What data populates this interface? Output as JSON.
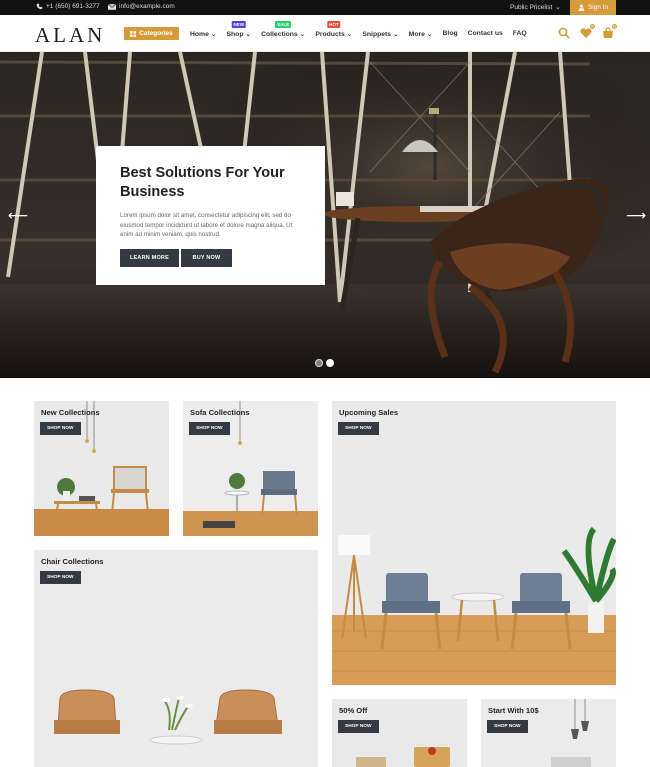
{
  "topbar": {
    "phone": "+1 (650) 691-3277",
    "email": "info@example.com",
    "pricelist": "Public Pricelist",
    "signin": "Sign In"
  },
  "header": {
    "logo": "ALAN",
    "categories": "Categories",
    "nav": [
      {
        "label": "Home",
        "dropdown": true
      },
      {
        "label": "Shop",
        "dropdown": true,
        "badge": "NEW",
        "badge_color": "#5b3fd6"
      },
      {
        "label": "Collections",
        "dropdown": true,
        "badge": "SALE",
        "badge_color": "#2ecc71"
      },
      {
        "label": "Products",
        "dropdown": true,
        "badge": "HOT",
        "badge_color": "#e74c3c"
      },
      {
        "label": "Snippets",
        "dropdown": true
      },
      {
        "label": "More",
        "dropdown": true
      },
      {
        "label": "Blog",
        "dropdown": false
      },
      {
        "label": "Contact us",
        "dropdown": false
      },
      {
        "label": "FAQ",
        "dropdown": false
      }
    ],
    "icons": {
      "search": "search-icon",
      "wishlist": "heart-icon",
      "cart": "cart-icon",
      "wishlist_count": "0",
      "cart_count": "0"
    }
  },
  "hero": {
    "title": "Best Solutions For Your Business",
    "text": "Lorem ipsum dolor sit amet, consectetur adipiscing elit, sed do eiusmod tempor incididunt ut labore et dolore magna aliqua. Ut enim ad minim veniam, quis nostrud.",
    "btn_learn": "LEARN MORE",
    "btn_buy": "BUY NOW",
    "slides": 2,
    "active_slide": 2
  },
  "collections": [
    {
      "title": "New Collections",
      "button": "SHOP NOW"
    },
    {
      "title": "Sofa Collections",
      "button": "SHOP NOW"
    },
    {
      "title": "Upcoming Sales",
      "button": "SHOP NOW"
    },
    {
      "title": "Chair Collections",
      "button": "SHOP NOW"
    },
    {
      "title": "50% Off",
      "button": "SHOP NOW"
    },
    {
      "title": "Start With 10$",
      "button": "SHOP NOW"
    }
  ],
  "colors": {
    "accent": "#d59a3a",
    "dark_button": "#333a44",
    "topbar": "#111111"
  }
}
